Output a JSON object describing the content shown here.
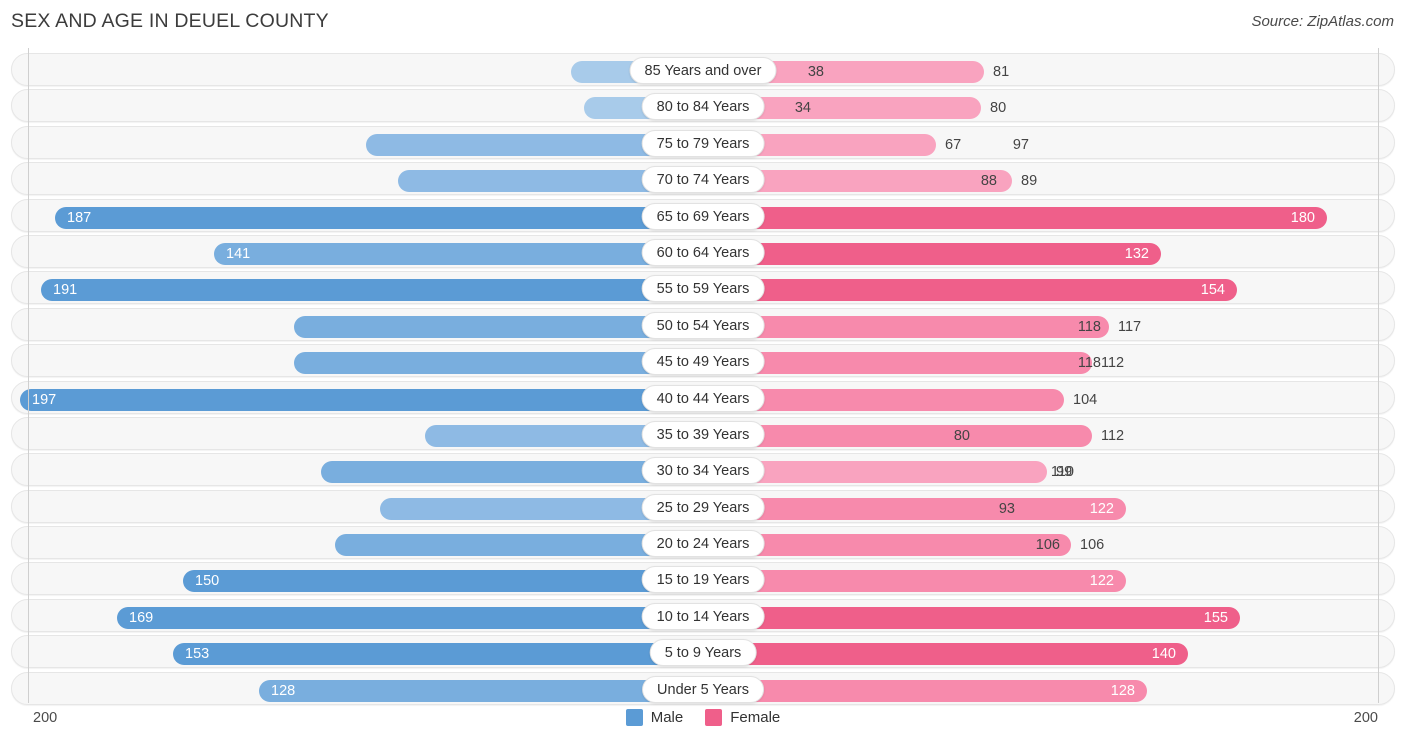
{
  "header": {
    "title": "SEX AND AGE IN DEUEL COUNTY",
    "source": "Source: ZipAtlas.com"
  },
  "legend": {
    "male_label": "Male",
    "female_label": "Female",
    "male_color": "#5b9bd5",
    "female_color": "#ef5f8a"
  },
  "axis": {
    "left_label": "200",
    "right_label": "200",
    "max": 200
  },
  "chart_data": {
    "type": "bar",
    "title": "SEX AND AGE IN DEUEL COUNTY",
    "subtitle": "Source: ZipAtlas.com",
    "xlabel": "",
    "ylabel": "",
    "orientation": "horizontal",
    "layout": "population-pyramid",
    "axis_max": 200,
    "xlim": [
      200,
      200
    ],
    "grid": false,
    "legend_position": "bottom-center",
    "categories": [
      "85 Years and over",
      "80 to 84 Years",
      "75 to 79 Years",
      "70 to 74 Years",
      "65 to 69 Years",
      "60 to 64 Years",
      "55 to 59 Years",
      "50 to 54 Years",
      "45 to 49 Years",
      "40 to 44 Years",
      "35 to 39 Years",
      "30 to 34 Years",
      "25 to 29 Years",
      "20 to 24 Years",
      "15 to 19 Years",
      "10 to 14 Years",
      "5 to 9 Years",
      "Under 5 Years"
    ],
    "series": [
      {
        "name": "Male",
        "color": "#5b9bd5",
        "values": [
          38,
          34,
          97,
          88,
          187,
          141,
          191,
          118,
          118,
          197,
          80,
          110,
          93,
          106,
          150,
          169,
          153,
          128
        ]
      },
      {
        "name": "Female",
        "color": "#ef5f8a",
        "values": [
          81,
          80,
          67,
          89,
          180,
          132,
          154,
          117,
          112,
          104,
          112,
          99,
          122,
          106,
          122,
          155,
          140,
          128
        ]
      }
    ]
  },
  "rows": [
    {
      "age": "85 Years and over",
      "male": 38,
      "female": 81,
      "male_inside": false,
      "female_inside": false
    },
    {
      "age": "80 to 84 Years",
      "male": 34,
      "female": 80,
      "male_inside": false,
      "female_inside": false
    },
    {
      "age": "75 to 79 Years",
      "male": 97,
      "female": 67,
      "male_inside": false,
      "female_inside": false
    },
    {
      "age": "70 to 74 Years",
      "male": 88,
      "female": 89,
      "male_inside": false,
      "female_inside": false
    },
    {
      "age": "65 to 69 Years",
      "male": 187,
      "female": 180,
      "male_inside": true,
      "female_inside": true
    },
    {
      "age": "60 to 64 Years",
      "male": 141,
      "female": 132,
      "male_inside": true,
      "female_inside": true
    },
    {
      "age": "55 to 59 Years",
      "male": 191,
      "female": 154,
      "male_inside": true,
      "female_inside": true
    },
    {
      "age": "50 to 54 Years",
      "male": 118,
      "female": 117,
      "male_inside": false,
      "female_inside": false
    },
    {
      "age": "45 to 49 Years",
      "male": 118,
      "female": 112,
      "male_inside": false,
      "female_inside": false
    },
    {
      "age": "40 to 44 Years",
      "male": 197,
      "female": 104,
      "male_inside": true,
      "female_inside": false
    },
    {
      "age": "35 to 39 Years",
      "male": 80,
      "female": 112,
      "male_inside": false,
      "female_inside": false
    },
    {
      "age": "30 to 34 Years",
      "male": 110,
      "female": 99,
      "male_inside": false,
      "female_inside": false
    },
    {
      "age": "25 to 29 Years",
      "male": 93,
      "female": 122,
      "male_inside": false,
      "female_inside": true
    },
    {
      "age": "20 to 24 Years",
      "male": 106,
      "female": 106,
      "male_inside": false,
      "female_inside": false
    },
    {
      "age": "15 to 19 Years",
      "male": 150,
      "female": 122,
      "male_inside": true,
      "female_inside": true
    },
    {
      "age": "10 to 14 Years",
      "male": 169,
      "female": 155,
      "male_inside": true,
      "female_inside": true
    },
    {
      "age": "5 to 9 Years",
      "male": 153,
      "female": 140,
      "male_inside": true,
      "female_inside": true
    },
    {
      "age": "Under 5 Years",
      "male": 128,
      "female": 128,
      "male_inside": true,
      "female_inside": true
    }
  ]
}
